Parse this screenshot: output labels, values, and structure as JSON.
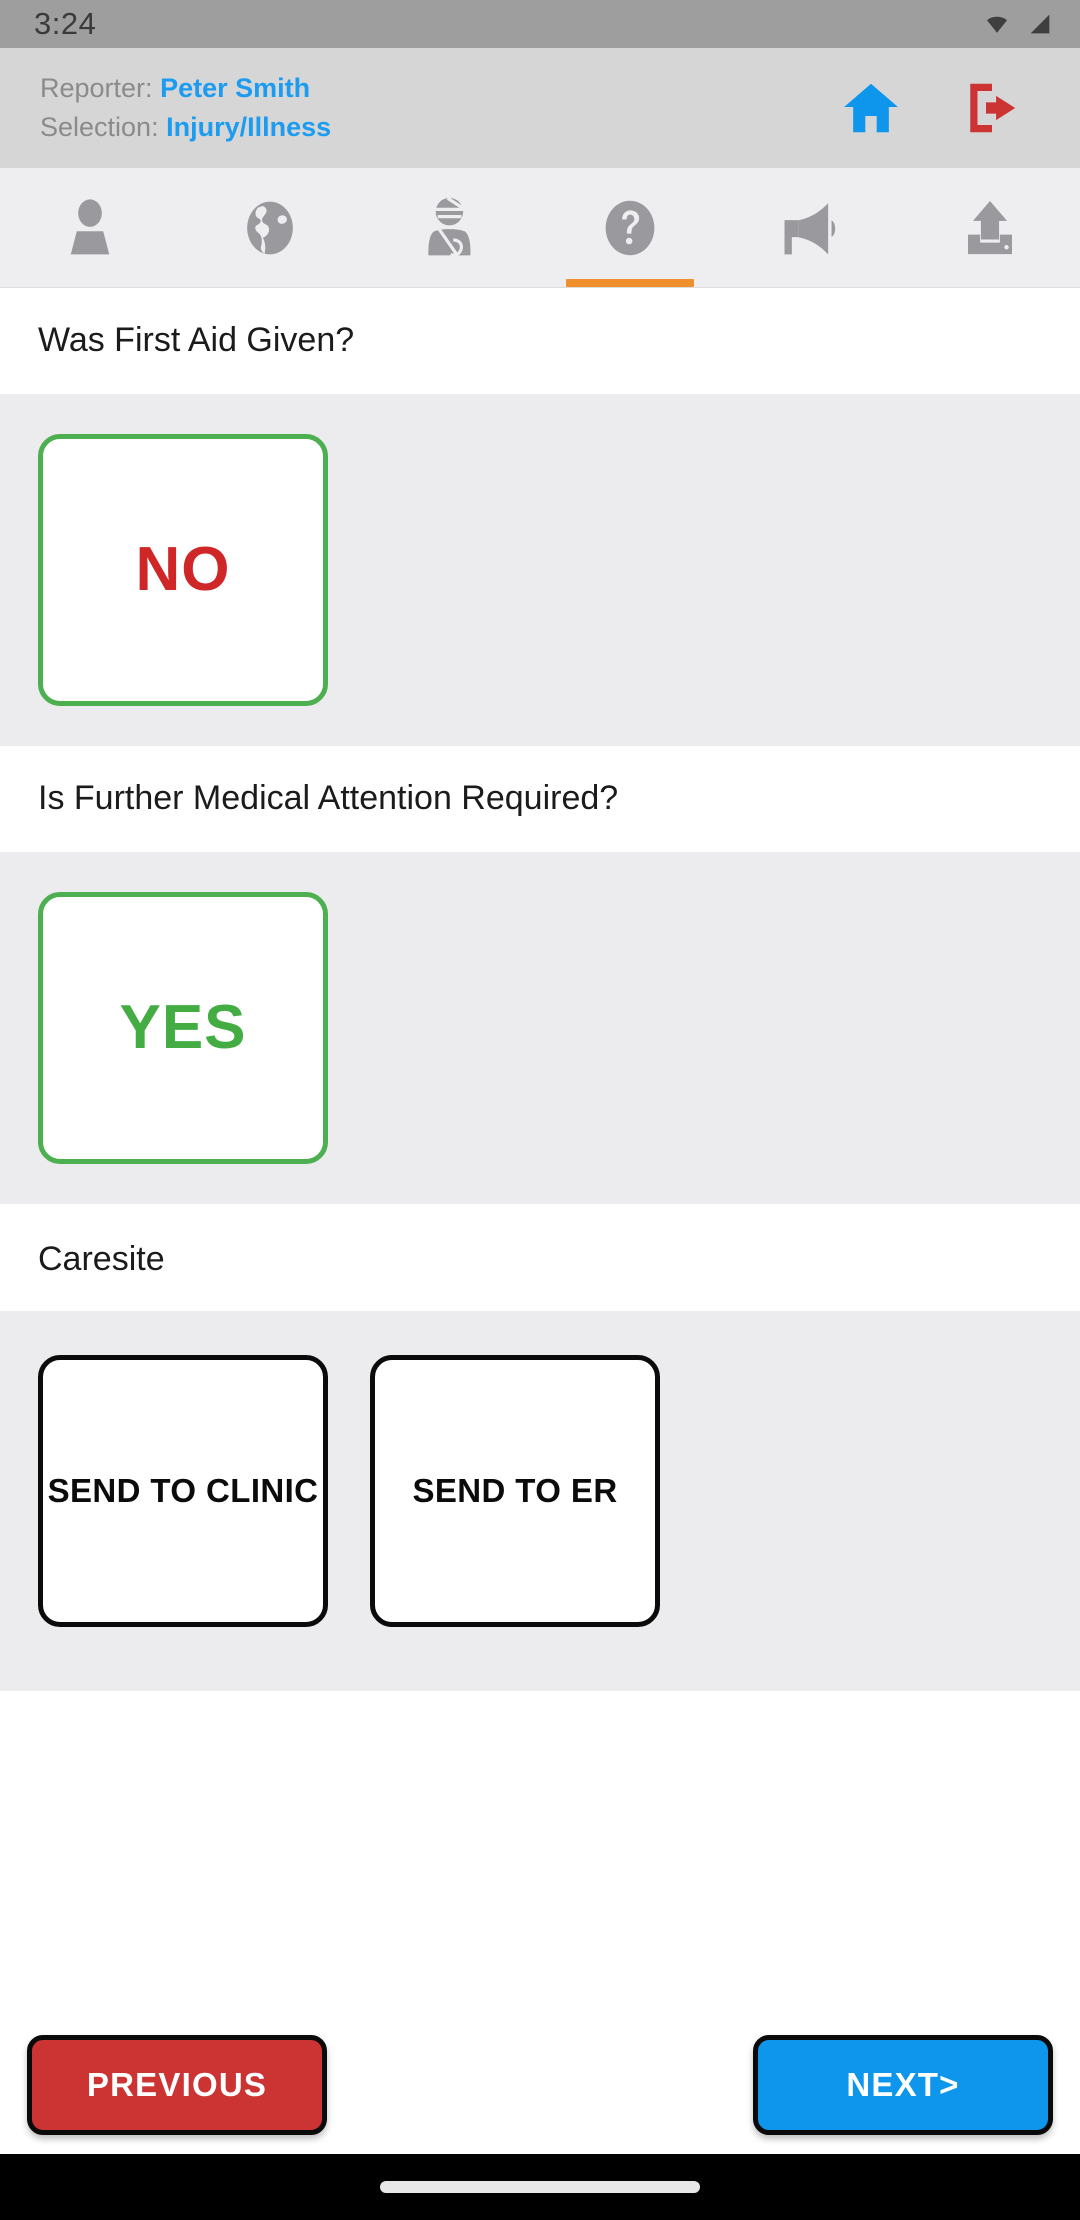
{
  "status_bar": {
    "time": "3:24",
    "icons": [
      "wifi-icon",
      "signal-icon"
    ]
  },
  "header": {
    "reporter_label": "Reporter:",
    "reporter_value": "Peter Smith",
    "selection_label": "Selection:",
    "selection_value": "Injury/Illness",
    "home_icon": "home-icon",
    "logout_icon": "logout-icon",
    "home_color": "#0d96ec",
    "logout_color": "#cc3333"
  },
  "tabs": {
    "active_index": 3,
    "indicator_color": "#f0902c",
    "items": [
      {
        "icon": "person-icon",
        "name": "tab-person"
      },
      {
        "icon": "globe-icon",
        "name": "tab-globe"
      },
      {
        "icon": "injured-person-icon",
        "name": "tab-injury"
      },
      {
        "icon": "question-circle-icon",
        "name": "tab-questions"
      },
      {
        "icon": "megaphone-icon",
        "name": "tab-announcement"
      },
      {
        "icon": "upload-icon",
        "name": "tab-upload"
      }
    ]
  },
  "sections": [
    {
      "question": "Was First Aid Given?",
      "options": [
        {
          "label": "NO",
          "style": "green-outline-red-text"
        }
      ]
    },
    {
      "question": "Is Further Medical Attention Required?",
      "options": [
        {
          "label": "YES",
          "style": "green-outline-green-text"
        }
      ]
    },
    {
      "question": "Caresite",
      "options": [
        {
          "label": "SEND TO CLINIC",
          "style": "black-outline-black-text"
        },
        {
          "label": "SEND TO ER",
          "style": "black-outline-black-text"
        }
      ]
    }
  ],
  "footer": {
    "previous_label": "PREVIOUS",
    "next_label": "NEXT>",
    "previous_color": "#cc3333",
    "next_color": "#0d96ec"
  },
  "colors": {
    "accent_orange": "#f0902c",
    "link_blue": "#1c9cf0",
    "green": "#4caf50",
    "red": "#cf2727"
  }
}
